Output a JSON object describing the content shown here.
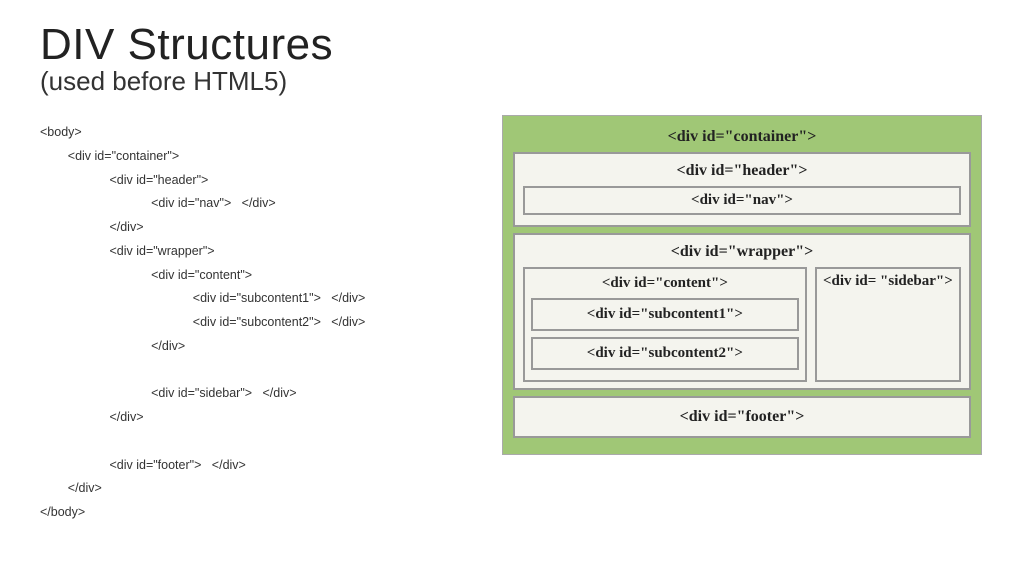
{
  "title": "DIV Structures",
  "subtitle": "(used before HTML5)",
  "code": "<body>\n        <div id=\"container\">\n                    <div id=\"header\">\n                                <div id=\"nav\">   </div>\n                    </div>\n                    <div id=\"wrapper\">\n                                <div id=\"content\">\n                                            <div id=\"subcontent1\">   </div>\n                                            <div id=\"subcontent2\">   </div>\n                                </div>\n\n                                <div id=\"sidebar\">   </div>\n                    </div>\n\n                    <div id=\"footer\">   </div>\n        </div>\n</body>",
  "diagram": {
    "container": "<div id=\"container\">",
    "header": "<div id=\"header\">",
    "nav": "<div id=\"nav\">",
    "wrapper": "<div id=\"wrapper\">",
    "content": "<div id=\"content\">",
    "subcontent1": "<div id=\"subcontent1\">",
    "subcontent2": "<div id=\"subcontent2\">",
    "sidebar": "<div id= \"sidebar\">",
    "footer": "<div id=\"footer\">"
  }
}
